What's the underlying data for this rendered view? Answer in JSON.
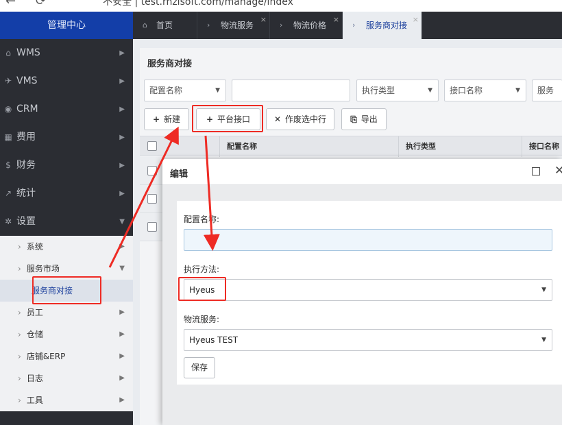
{
  "browser": {
    "url_text": "不安全  |  test.rnzisoft.com/manage/index"
  },
  "sidebar": {
    "brand": "管理中心",
    "items": [
      {
        "icon": "bank-icon",
        "glyph": "⌂",
        "label": "WMS"
      },
      {
        "icon": "truck-icon",
        "glyph": "✈",
        "label": "VMS"
      },
      {
        "icon": "user-circle-icon",
        "glyph": "◉",
        "label": "CRM"
      },
      {
        "icon": "table-icon",
        "glyph": "▦",
        "label": "费用"
      },
      {
        "icon": "dollar-icon",
        "glyph": "$",
        "label": "财务"
      },
      {
        "icon": "chart-line-icon",
        "glyph": "↗",
        "label": "统计"
      },
      {
        "icon": "gear-icon",
        "glyph": "✲",
        "label": "设置"
      }
    ],
    "submenu": [
      {
        "label": "系统"
      },
      {
        "label": "服务市场"
      },
      {
        "label": "服务商对接"
      },
      {
        "label": "员工"
      },
      {
        "label": "仓储"
      },
      {
        "label": "店铺&ERP"
      },
      {
        "label": "日志"
      },
      {
        "label": "工具"
      }
    ]
  },
  "tabs": [
    {
      "label": "首页"
    },
    {
      "label": "物流服务"
    },
    {
      "label": "物流价格"
    },
    {
      "label": "服务商对接"
    }
  ],
  "main": {
    "title": "服务商对接",
    "filters": {
      "config_name": "配置名称",
      "exec_type": "执行类型",
      "interface_name": "接口名称",
      "service": "服务"
    },
    "toolbar": {
      "new": "新建",
      "platform_interface": "平台接口",
      "void_selected": "作废选中行",
      "export": "导出"
    },
    "columns": [
      "配置名称",
      "执行类型",
      "接口名称"
    ]
  },
  "modal": {
    "title": "编辑",
    "fields": {
      "config_name_label": "配置名称:",
      "config_name_value": "",
      "exec_method_label": "执行方法:",
      "exec_method_value": "Hyeus",
      "logistics_service_label": "物流服务:",
      "logistics_service_value": "Hyeus TEST"
    },
    "save": "保存"
  },
  "annotation_color": "#ee2b24"
}
